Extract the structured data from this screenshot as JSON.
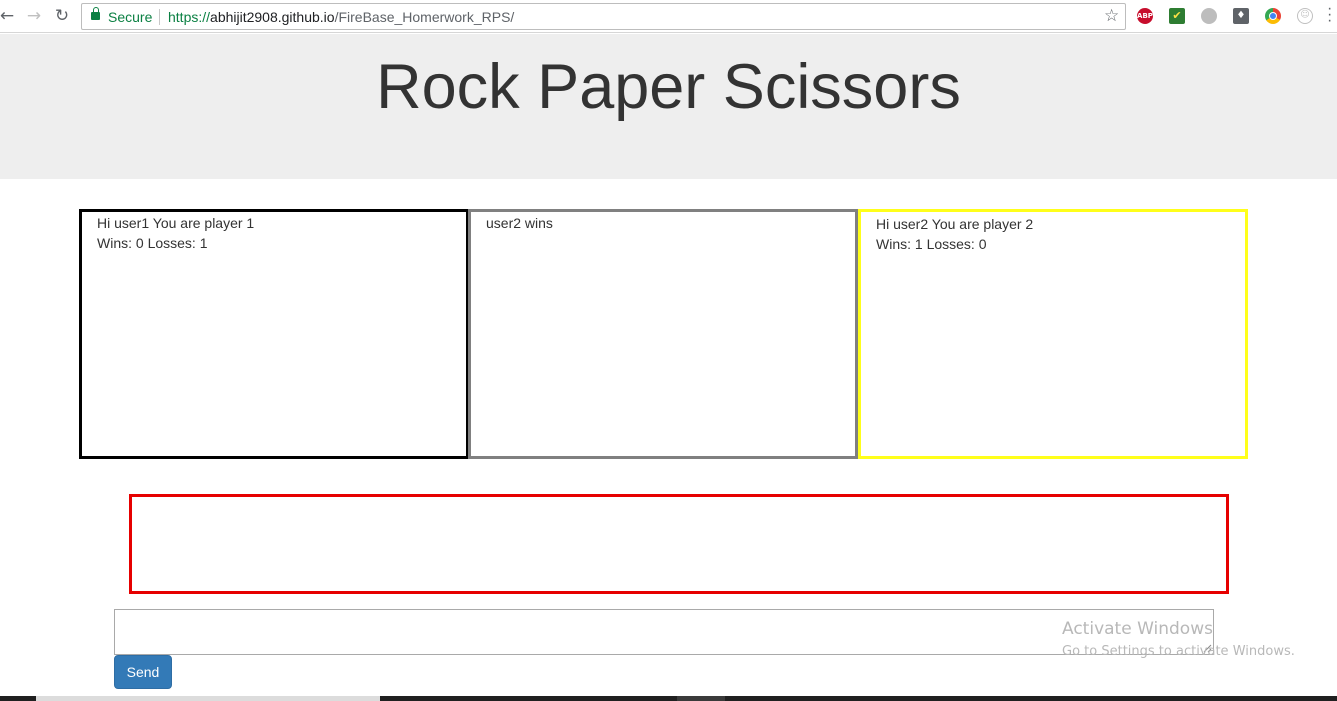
{
  "browser": {
    "secure_label": "Secure",
    "url_scheme": "https://",
    "url_host": "abhijit2908.github.io",
    "url_path": "/FireBase_Homerwork_RPS/",
    "extensions": [
      "adblock-plus-icon",
      "checkbox-extension-icon",
      "circle-extension-icon",
      "bulb-extension-icon",
      "chrome-extension-icon",
      "smile-extension-icon"
    ],
    "abp_label": "ABP"
  },
  "page": {
    "title": "Rock Paper Scissors"
  },
  "player1": {
    "greeting": "Hi user1 You are player 1",
    "stats": "Wins: 0 Losses: 1",
    "border_color": "#000000"
  },
  "result": {
    "text": "user2 wins",
    "border_color": "#808080"
  },
  "player2": {
    "greeting": "Hi user2 You are player 2",
    "stats": "Wins: 1 Losses: 0",
    "border_color": "#ffff1a"
  },
  "chat": {
    "log_border_color": "#e60000",
    "input_value": "",
    "send_label": "Send",
    "send_color": "#337ab7"
  },
  "watermark": {
    "title": "Activate Windows",
    "subtitle": "Go to Settings to activate Windows."
  }
}
